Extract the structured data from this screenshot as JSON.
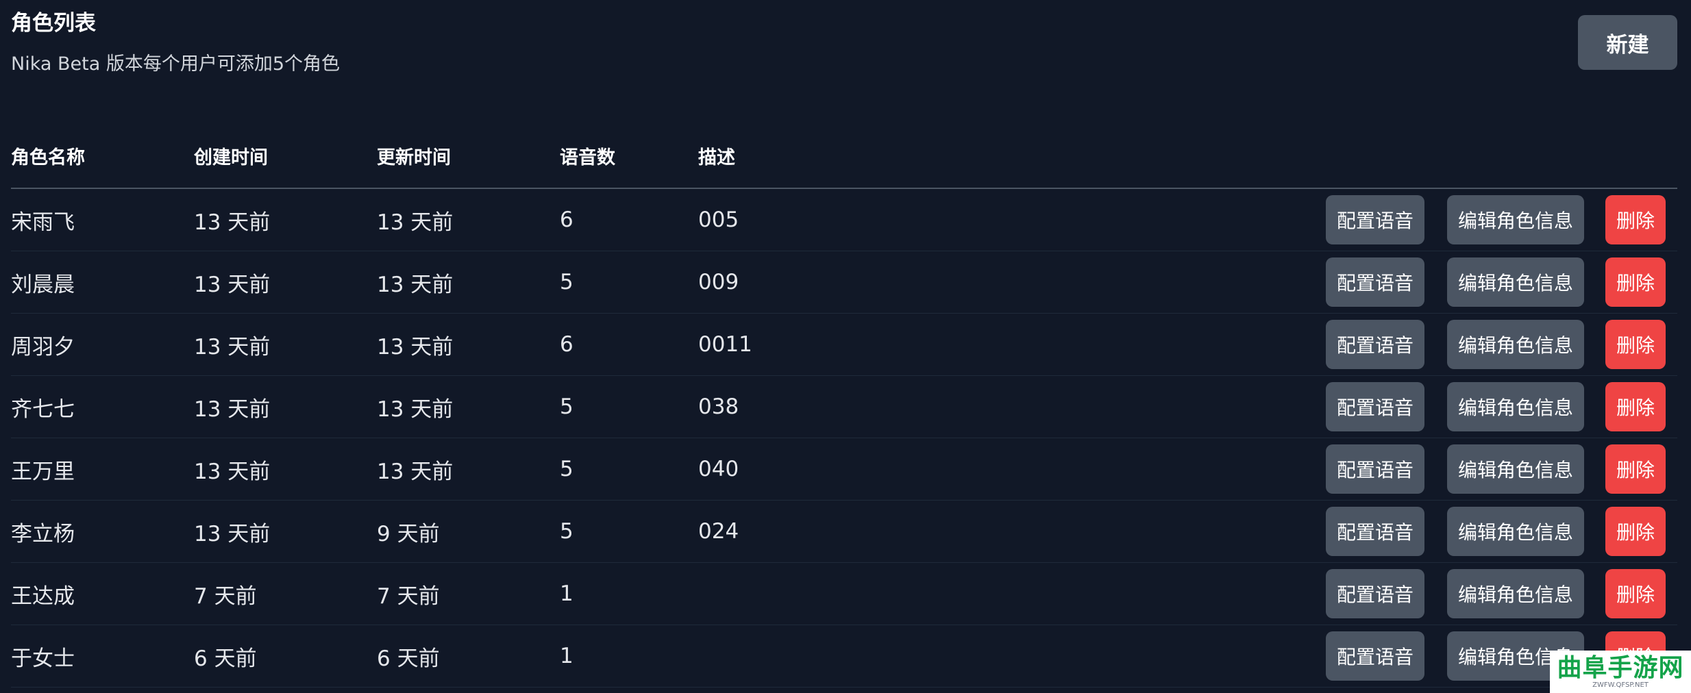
{
  "header": {
    "title": "角色列表",
    "subtitle": "Nika Beta 版本每个用户可添加5个角色",
    "new_button": "新建"
  },
  "table": {
    "columns": [
      "角色名称",
      "创建时间",
      "更新时间",
      "语音数",
      "描述"
    ],
    "action_labels": {
      "config": "配置语音",
      "edit": "编辑角色信息",
      "delete": "删除"
    },
    "rows": [
      {
        "name": "宋雨飞",
        "created": "13 天前",
        "updated": "13 天前",
        "voices": "6",
        "desc": "005"
      },
      {
        "name": "刘晨晨",
        "created": "13 天前",
        "updated": "13 天前",
        "voices": "5",
        "desc": "009"
      },
      {
        "name": "周羽夕",
        "created": "13 天前",
        "updated": "13 天前",
        "voices": "6",
        "desc": "0011"
      },
      {
        "name": "齐七七",
        "created": "13 天前",
        "updated": "13 天前",
        "voices": "5",
        "desc": "038"
      },
      {
        "name": "王万里",
        "created": "13 天前",
        "updated": "13 天前",
        "voices": "5",
        "desc": "040"
      },
      {
        "name": "李立杨",
        "created": "13 天前",
        "updated": "9 天前",
        "voices": "5",
        "desc": "024"
      },
      {
        "name": "王达成",
        "created": "7 天前",
        "updated": "7 天前",
        "voices": "1",
        "desc": ""
      },
      {
        "name": "于女士",
        "created": "6 天前",
        "updated": "6 天前",
        "voices": "1",
        "desc": ""
      }
    ]
  },
  "watermark": {
    "main": "曲阜手游网",
    "sub": "ZWFW.QFSP.NET"
  },
  "colors": {
    "background": "#111827",
    "button_gray": "#4b5563",
    "delete_red": "#ef4444",
    "watermark_green": "#14a34a"
  }
}
